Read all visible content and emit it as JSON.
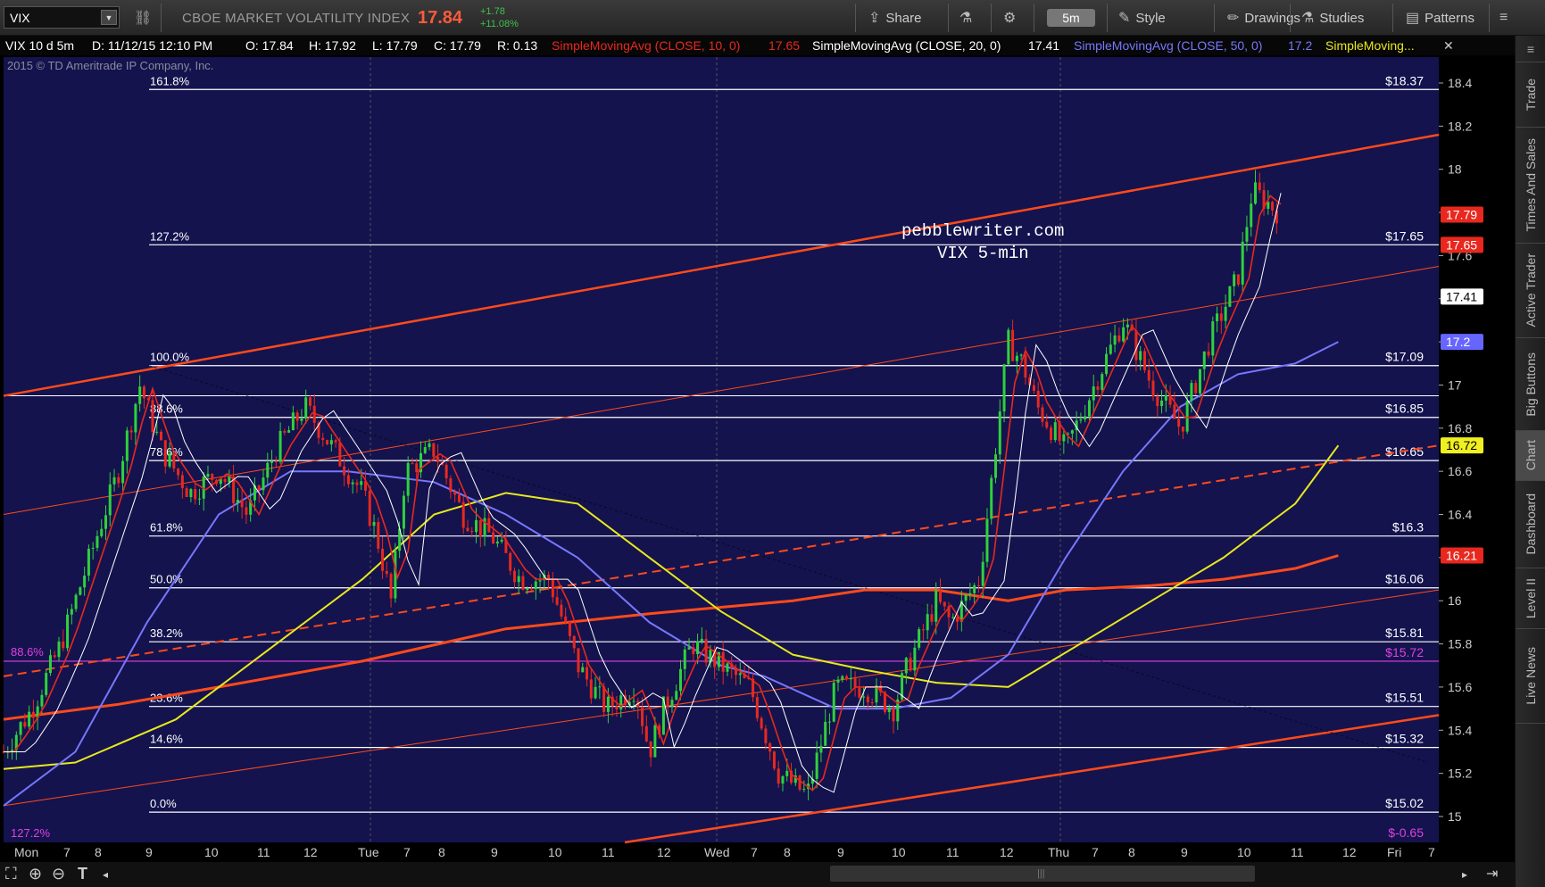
{
  "toolbar": {
    "symbol": "VIX",
    "instrument_name": "CBOE MARKET VOLATILITY INDEX",
    "last_price": "17.84",
    "net_change": "+1.78",
    "pct_change": "+11.08%",
    "share_label": "Share",
    "timeframe_label": "5m",
    "style_label": "Style",
    "drawings_label": "Drawings",
    "studies_label": "Studies",
    "patterns_label": "Patterns"
  },
  "infobar": {
    "symbol_period": "VIX 10 d 5m",
    "datetime": "D: 11/12/15 12:10 PM",
    "open": "O: 17.84",
    "high": "H: 17.92",
    "low": "L: 17.79",
    "close": "C: 17.79",
    "range": "R: 0.13",
    "sma10_label": "SimpleMovingAvg (CLOSE, 10, 0)",
    "sma10_value": "17.65",
    "sma20_label": "SimpleMovingAvg (CLOSE, 20, 0)",
    "sma20_value": "17.41",
    "sma50_label": "SimpleMovingAvg (CLOSE, 50, 0)",
    "sma50_value": "17.2",
    "sma_more": "SimpleMoving..."
  },
  "colors": {
    "background": "#14134e",
    "sma10": "#e8281e",
    "sma20": "#ffffff",
    "sma50": "#7777ff",
    "sma100": "#e8e81e",
    "sma200": "#ff4a1a",
    "channel": "#ff4a1a",
    "fib": "#ffffff",
    "pink_level": "#e040e0",
    "up_candle": "#2fd13c",
    "down_candle": "#e8281e"
  },
  "chart_data": {
    "type": "line",
    "subtype": "candlestick",
    "symbol": "VIX",
    "interval": "5m",
    "copyright": "2015 © TD Ameritrade IP Company, Inc.",
    "annotation": [
      "pebblewriter.com",
      "VIX 5-min"
    ],
    "ylim": [
      14.88,
      18.52
    ],
    "y_ticks": [
      15,
      15.2,
      15.4,
      15.6,
      15.8,
      16,
      16.2,
      16.4,
      16.6,
      16.8,
      17,
      17.2,
      17.4,
      17.6,
      17.8,
      18,
      18.2,
      18.4
    ],
    "x_tick_labels": [
      "Mon",
      "7",
      "8",
      "9",
      "10",
      "11",
      "12",
      "Tue",
      "7",
      "8",
      "9",
      "10",
      "11",
      "12",
      "Wed",
      "7",
      "8",
      "9",
      "10",
      "11",
      "12",
      "Thu",
      "7",
      "8",
      "9",
      "10",
      "11",
      "12",
      "Fri",
      "7"
    ],
    "day_separators": [
      "Tue",
      "Wed",
      "Thu"
    ],
    "fib_levels": [
      {
        "label": "161.8%",
        "price": "$18.37",
        "value": 18.37
      },
      {
        "label": "127.2%",
        "price": "$17.65",
        "value": 17.65
      },
      {
        "label": "100.0%",
        "price": "$17.09",
        "value": 17.09
      },
      {
        "label": "88.6%",
        "price": "$16.85",
        "value": 16.85
      },
      {
        "label": "78.6%",
        "price": "$16.65",
        "value": 16.65
      },
      {
        "label": "61.8%",
        "price": "$16.3",
        "value": 16.3
      },
      {
        "label": "50.0%",
        "price": "$16.06",
        "value": 16.06
      },
      {
        "label": "38.2%",
        "price": "$15.81",
        "value": 15.81
      },
      {
        "label": "23.6%",
        "price": "$15.51",
        "value": 15.51
      },
      {
        "label": "14.6%",
        "price": "$15.32",
        "value": 15.32
      },
      {
        "label": "0.0%",
        "price": "$15.02",
        "value": 15.02
      }
    ],
    "extra_level": {
      "label": "88.6%",
      "price": "$15.72",
      "value": 15.72
    },
    "extra_label_bottom": {
      "label": "127.2%",
      "price": "$-0.65"
    },
    "price_tags": [
      {
        "text": "17.79",
        "value": 17.79,
        "bg": "#e8281e",
        "fg": "#ffffff"
      },
      {
        "text": "17.65",
        "value": 17.65,
        "bg": "#e8281e",
        "fg": "#ffffff"
      },
      {
        "text": "17.41",
        "value": 17.41,
        "bg": "#ffffff",
        "fg": "#000000"
      },
      {
        "text": "17.2",
        "value": 17.2,
        "bg": "#6666ff",
        "fg": "#ffffff"
      },
      {
        "text": "16.72",
        "value": 16.72,
        "bg": "#f0f020",
        "fg": "#000000"
      },
      {
        "text": "16.21",
        "value": 16.21,
        "bg": "#e8281e",
        "fg": "#ffffff"
      }
    ],
    "series": [
      {
        "name": "SimpleMovingAvg (CLOSE, 10, 0)",
        "last": 17.65
      },
      {
        "name": "SimpleMovingAvg (CLOSE, 20, 0)",
        "last": 17.41
      },
      {
        "name": "SimpleMovingAvg (CLOSE, 50, 0)",
        "last": 17.2
      }
    ],
    "sma_paths": {
      "sma200": [
        [
          0,
          15.45
        ],
        [
          0.08,
          15.52
        ],
        [
          0.15,
          15.6
        ],
        [
          0.25,
          15.72
        ],
        [
          0.35,
          15.87
        ],
        [
          0.45,
          15.94
        ],
        [
          0.55,
          16.0
        ],
        [
          0.6,
          16.05
        ],
        [
          0.65,
          16.05
        ],
        [
          0.7,
          16.0
        ],
        [
          0.74,
          16.05
        ],
        [
          0.8,
          16.07
        ],
        [
          0.85,
          16.1
        ],
        [
          0.9,
          16.15
        ],
        [
          0.93,
          16.21
        ]
      ],
      "sma100": [
        [
          0,
          15.22
        ],
        [
          0.05,
          15.25
        ],
        [
          0.12,
          15.45
        ],
        [
          0.18,
          15.75
        ],
        [
          0.25,
          16.1
        ],
        [
          0.3,
          16.4
        ],
        [
          0.35,
          16.5
        ],
        [
          0.4,
          16.45
        ],
        [
          0.45,
          16.2
        ],
        [
          0.5,
          15.95
        ],
        [
          0.55,
          15.75
        ],
        [
          0.6,
          15.68
        ],
        [
          0.65,
          15.62
        ],
        [
          0.7,
          15.6
        ],
        [
          0.75,
          15.8
        ],
        [
          0.8,
          16.0
        ],
        [
          0.85,
          16.2
        ],
        [
          0.9,
          16.45
        ],
        [
          0.93,
          16.72
        ]
      ],
      "sma50": [
        [
          0,
          15.05
        ],
        [
          0.05,
          15.3
        ],
        [
          0.1,
          15.9
        ],
        [
          0.15,
          16.4
        ],
        [
          0.2,
          16.6
        ],
        [
          0.24,
          16.6
        ],
        [
          0.3,
          16.55
        ],
        [
          0.35,
          16.4
        ],
        [
          0.4,
          16.2
        ],
        [
          0.45,
          15.9
        ],
        [
          0.5,
          15.7
        ],
        [
          0.53,
          15.65
        ],
        [
          0.58,
          15.5
        ],
        [
          0.62,
          15.5
        ],
        [
          0.66,
          15.55
        ],
        [
          0.7,
          15.75
        ],
        [
          0.74,
          16.2
        ],
        [
          0.78,
          16.6
        ],
        [
          0.82,
          16.9
        ],
        [
          0.86,
          17.05
        ],
        [
          0.9,
          17.1
        ],
        [
          0.93,
          17.2
        ]
      ]
    },
    "candles_summary": {
      "start": 15.2,
      "end": 17.79,
      "high": 17.98,
      "low": 15.02
    }
  },
  "rightbar": {
    "tabs": [
      "Trade",
      "Times And Sales",
      "Active Trader",
      "Big Buttons",
      "Chart",
      "Dashboard",
      "Level II",
      "Live News"
    ],
    "active": "Chart"
  }
}
